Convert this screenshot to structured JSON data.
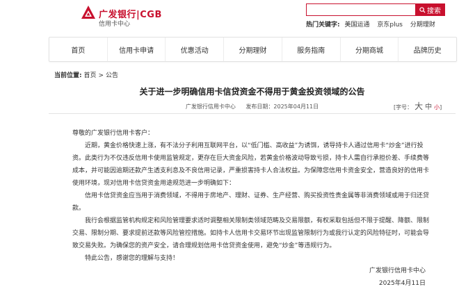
{
  "header": {
    "bank_name": "广发银行|CGB",
    "bank_sub": "信用卡中心",
    "search": {
      "placeholder": "",
      "button_label": "搜索"
    },
    "hot_label": "热门关键字:",
    "hot_links": [
      "美国运通",
      "京东plus",
      "分期理财"
    ]
  },
  "nav": {
    "items": [
      "首页",
      "信用卡申请",
      "优惠活动",
      "分期理财",
      "服务指南",
      "分期商城",
      "品牌历史"
    ]
  },
  "breadcrumb": {
    "label": "当前位置:",
    "items": [
      "首页",
      "公告"
    ],
    "separator": ">"
  },
  "article": {
    "title": "关于进一步明确信用卡信贷资金不得用于黄金投资领域的公告",
    "source": "广发银行信用卡中心",
    "date": "发布日期：2025年04月11日",
    "font_size": {
      "label": "[字号：",
      "large": "大",
      "medium": "中",
      "small": "小",
      "end": "]"
    },
    "greeting": "尊敬的广发银行信用卡客户：",
    "paragraphs": [
      "近期，黄金价格快速上涨，有不法分子利用互联网平台，以“低门槛、高收益”为诱饵，诱导持卡人通过信用卡“炒金”进行投资。此类行为不仅违反信用卡使用监管规定，更存在巨大资金风险，若黄金价格波动导致亏损，持卡人需自行承担价差、手续费等成本，并可能因逾期还款产生透支利息及不良信用记录，严重损害持卡人合法权益。为保障您信用卡资金安全，营造良好的信用卡使用环境，现对信用卡信贷资金用途规范进一步明确如下：",
      "信用卡信贷资金应当用于消费领域，不得用于房地产、理财、证券、生产经营、购买投资性贵金属等非消费领域或用于归还贷款。",
      "我行会根据监管机构规定和风险管理要求适时调整相关限制类领域范畴及交易限额，有权采取包括但不限于提醒、降额、限制交易、限制分期、要求提前还款等风险管控措施。如持卡人信用卡交易环节出现监管限制行为或我行认定的风险特征时，可能会导致交易失败。为确保您的资产安全，请合理规划信用卡信贷资金使用，避免“炒金”等违规行为。",
      "特此公告，感谢您的理解与支持！"
    ],
    "signature": "广发银行信用卡中心",
    "signature_date": "2025年4月11日"
  },
  "colors": {
    "brand": "#c8102e"
  },
  "icons": [
    "cgb-logo-icon",
    "search-icon"
  ]
}
